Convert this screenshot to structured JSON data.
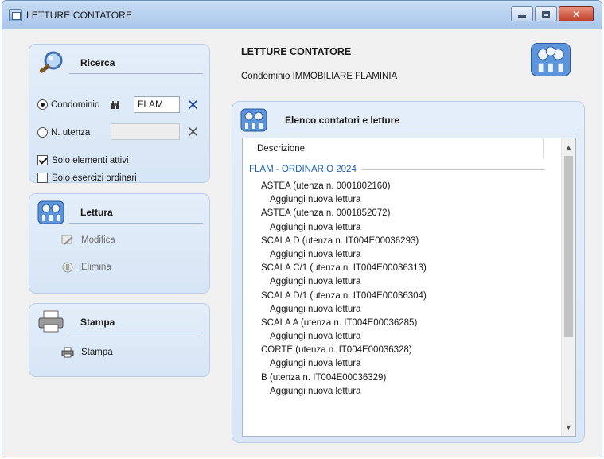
{
  "window": {
    "title": "LETTURE CONTATORE",
    "buttons": {
      "minimize": "–",
      "maximize": "□",
      "close": "✕"
    }
  },
  "sidebar": {
    "ricerca": {
      "title": "Ricerca",
      "condominio_label": "Condominio",
      "condominio_value": "FLAM",
      "utenza_label": "N. utenza",
      "utenza_value": "",
      "solo_attivi_label": "Solo elementi attivi",
      "solo_ordinari_label": "Solo esercizi ordinari",
      "solo_attivi_checked": true,
      "solo_ordinari_checked": false,
      "selected_radio": "condominio"
    },
    "lettura": {
      "title": "Lettura",
      "modifica_label": "Modifica",
      "elimina_label": "Elimina"
    },
    "stampa": {
      "title": "Stampa",
      "stampa_label": "Stampa"
    }
  },
  "header": {
    "title": "LETTURE CONTATORE",
    "subtitle": "Condominio IMMOBILIARE FLAMINIA"
  },
  "list": {
    "title": "Elenco contatori e letture",
    "column_header": "Descrizione",
    "group_label": "FLAM - ORDINARIO 2024",
    "rows": [
      {
        "type": "meter",
        "text": "ASTEA (utenza n. 0001802160)"
      },
      {
        "type": "add",
        "text": "Aggiungi nuova lettura"
      },
      {
        "type": "meter",
        "text": "ASTEA (utenza n. 0001852072)"
      },
      {
        "type": "add",
        "text": "Aggiungi nuova lettura"
      },
      {
        "type": "meter",
        "text": "SCALA D (utenza n. IT004E00036293)"
      },
      {
        "type": "add",
        "text": "Aggiungi nuova lettura"
      },
      {
        "type": "meter",
        "text": "SCALA C/1 (utenza n. IT004E00036313)"
      },
      {
        "type": "add",
        "text": "Aggiungi nuova lettura"
      },
      {
        "type": "meter",
        "text": "SCALA D/1 (utenza n. IT004E00036304)"
      },
      {
        "type": "add",
        "text": "Aggiungi nuova lettura"
      },
      {
        "type": "meter",
        "text": "SCALA A (utenza n. IT004E00036285)"
      },
      {
        "type": "add",
        "text": "Aggiungi nuova lettura"
      },
      {
        "type": "meter",
        "text": "CORTE (utenza n. IT004E00036328)"
      },
      {
        "type": "add",
        "text": "Aggiungi nuova lettura"
      },
      {
        "type": "meter",
        "text": "B (utenza n. IT004E00036329)"
      },
      {
        "type": "add",
        "text": "Aggiungi nuova lettura"
      }
    ]
  },
  "colors": {
    "accent_blue": "#1f5fb0",
    "panel_bg": "#dde9f7",
    "clear_x_active": "#1a44a8"
  }
}
